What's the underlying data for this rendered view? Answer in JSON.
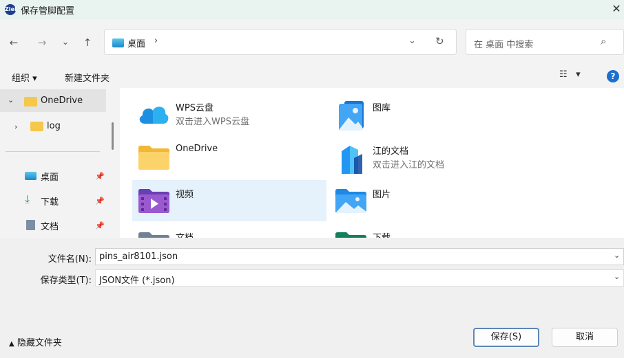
{
  "window": {
    "title": "保存管脚配置",
    "app_icon_text": "Ziel"
  },
  "nav": {
    "back": "←",
    "forward": "→",
    "recent": "⌄",
    "up": "↑"
  },
  "address": {
    "crumb": "桌面",
    "separator": "›"
  },
  "search": {
    "placeholder": "在 桌面 中搜索"
  },
  "toolbar": {
    "organize": "组织 ▾",
    "new_folder": "新建文件夹",
    "view": "▾"
  },
  "sidebar": {
    "items": [
      {
        "label": "OneDrive",
        "expanded": true
      },
      {
        "label": "log"
      },
      {
        "label": "桌面",
        "pinned": true
      },
      {
        "label": "下载",
        "pinned": true
      },
      {
        "label": "文档",
        "pinned": true
      }
    ]
  },
  "content": {
    "items": [
      {
        "name": "WPS云盘",
        "sub": "双击进入WPS云盘",
        "icon": "cloud-icon"
      },
      {
        "name": "图库",
        "sub": "",
        "icon": "gallery-icon"
      },
      {
        "name": "OneDrive",
        "sub": "",
        "icon": "folder-icon"
      },
      {
        "name": "江的文档",
        "sub": "双击进入江的文档",
        "icon": "document-app-icon"
      },
      {
        "name": "视频",
        "sub": "",
        "icon": "video-folder-icon",
        "selected": true
      },
      {
        "name": "图片",
        "sub": "",
        "icon": "pictures-folder-icon"
      },
      {
        "name": "文档",
        "sub": "",
        "icon": "documents-folder-icon"
      },
      {
        "name": "下载",
        "sub": "",
        "icon": "downloads-folder-icon"
      }
    ]
  },
  "form": {
    "filename_label": "文件名(N):",
    "filename_value": "pins_air8101.json",
    "filetype_label": "保存类型(T):",
    "filetype_value": "JSON文件 (*.json)"
  },
  "footer": {
    "hide_folders": "隐藏文件夹",
    "save": "保存(S)",
    "cancel": "取消"
  },
  "colors": {
    "selection": "#e5f1fb",
    "accent": "#1a6fd0",
    "titlebar": "#e9f3ef"
  }
}
